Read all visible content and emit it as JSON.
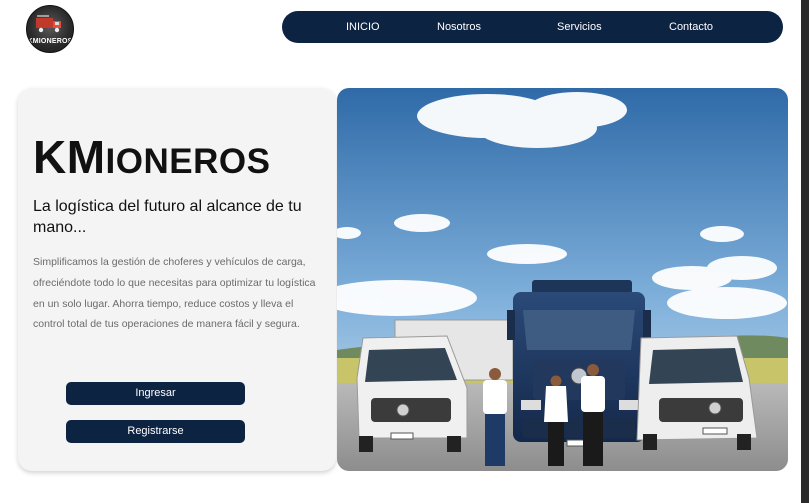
{
  "logo": {
    "text": "KMIONEROS"
  },
  "nav": {
    "items": [
      "INICIO",
      "Nosotros",
      "Servicios",
      "Contacto"
    ]
  },
  "hero": {
    "title_big": "KM",
    "title_small": "IONEROS",
    "tagline": "La logística del futuro al alcance de tu mano...",
    "description": "Simplificamos la gestión de choferes y vehículos de carga, ofreciéndote todo lo que necesitas para optimizar tu logística en un solo lugar. Ahorra tiempo, reduce costos y lleva el control total de tus operaciones de manera fácil y segura.",
    "buttons": {
      "login": "Ingresar",
      "register": "Registrarse"
    }
  },
  "colors": {
    "navy": "#0d2342",
    "card": "#f4f4f4",
    "text_muted": "#6b6b6b"
  }
}
